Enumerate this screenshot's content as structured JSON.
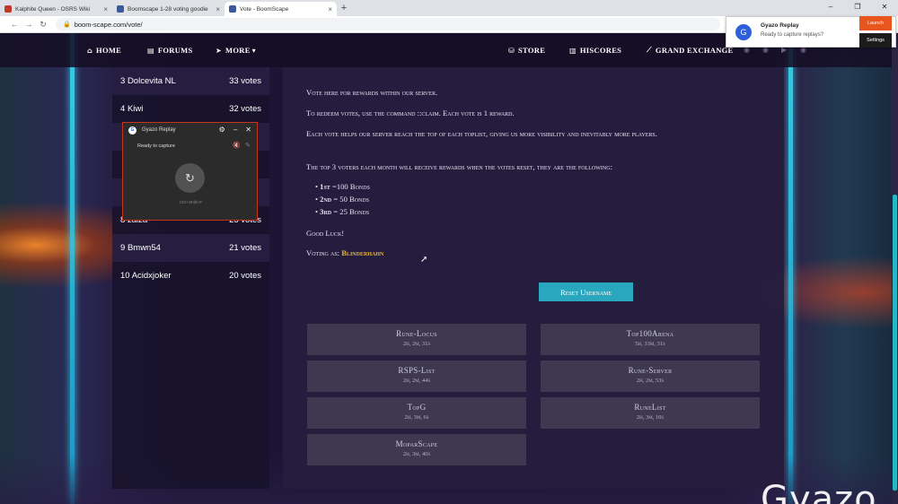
{
  "browser": {
    "tabs": [
      {
        "title": "Kalphite Queen - OSRS Wiki",
        "icon": "osrs-wiki-favicon",
        "color": "#c0392b"
      },
      {
        "title": "Boomscape 1-28 voting goodie",
        "icon": "boomscape-favicon",
        "color": "#3c5a9a"
      },
      {
        "title": "Vote - BoomScape",
        "icon": "boomscape-favicon",
        "color": "#3c5a9a"
      }
    ],
    "url": "boom-scape.com/vote/"
  },
  "navbar": {
    "home": "HOME",
    "forums": "FORUMS",
    "more": "MORE",
    "store": "STORE",
    "hiscores": "HISCORES",
    "grand_exchange": "GRAND EXCHANGE"
  },
  "leaderboard": [
    {
      "rank": "3",
      "name": "Dolcevita NL",
      "votes": "33 votes"
    },
    {
      "rank": "4",
      "name": "Kiwi",
      "votes": "32 votes"
    },
    {
      "rank": "8",
      "name": "zaiza",
      "votes": "25 votes"
    },
    {
      "rank": "9",
      "name": "Bmwn54",
      "votes": "21 votes"
    },
    {
      "rank": "10",
      "name": "Acidxjoker",
      "votes": "20 votes"
    }
  ],
  "main": {
    "intro": "Vote here for rewards within our server.",
    "redeem": "To redeem votes, use the command ::claim. Each vote is 1 reward.",
    "helps": "Each vote helps our server reach the top of each toplist, giving us more visibility and inevitably more players.",
    "top3": "The top 3 voters each month will receive rewards when the votes reset, they are the following:",
    "rewards": [
      {
        "place": "1st",
        "reward": "=100 Bonds"
      },
      {
        "place": "2nd",
        "reward": "= 50 Bonds"
      },
      {
        "place": "3rd",
        "reward": "= 25 Bonds"
      }
    ],
    "good_luck": "Good Luck!",
    "voting_as_label": "Voting as:",
    "voting_as_user": "Blinderhahn",
    "reset_button": "Reset Username"
  },
  "vote_sites": [
    {
      "name": "Rune-Locus",
      "time": "2h, 2m, 31s"
    },
    {
      "name": "Top100Arena",
      "time": "5h, 33m, 31s"
    },
    {
      "name": "RSPS-List",
      "time": "2h, 2m, 44s"
    },
    {
      "name": "Rune-Server",
      "time": "2h, 2m, 53s"
    },
    {
      "name": "TopG",
      "time": "2h, 3m, 6s"
    },
    {
      "name": "RuneList",
      "time": "2h, 3m, 10s"
    },
    {
      "name": "MoparScape",
      "time": "2h, 3m, 40s"
    }
  ],
  "gyazo_popup": {
    "title": "Gyazo Replay",
    "status": "Ready to capture",
    "shortcut": "Ctrl+Shift+F"
  },
  "gyazo_notice": {
    "title": "Gyazo Replay",
    "subtitle": "Ready to capture replays?",
    "launch": "Launch",
    "settings": "Settings"
  },
  "watermark": "Gyazo"
}
